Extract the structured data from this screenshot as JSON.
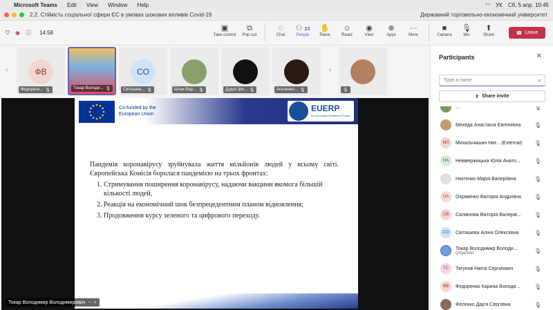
{
  "menubar": {
    "app": "Microsoft Teams",
    "items": [
      "Edit",
      "View",
      "Window",
      "Help"
    ],
    "lang": "УК",
    "clock": "Сб, 5 апр.  10:45"
  },
  "window": {
    "title": "2.2. Стійкість соціальної сфери ЄС в умовах шокових впливів Covid-19",
    "org": "Державний торговельно-економічний університет"
  },
  "toolbar": {
    "timer": "14:58",
    "tools": [
      {
        "label": "Take control",
        "icon": "hand-screen-icon"
      },
      {
        "label": "Pop out",
        "icon": "pop-out-icon"
      },
      {
        "label": "Chat",
        "icon": "chat-icon"
      },
      {
        "label": "People",
        "icon": "people-icon",
        "count": "23"
      },
      {
        "label": "Raise",
        "icon": "raise-hand-icon"
      },
      {
        "label": "React",
        "icon": "react-icon"
      },
      {
        "label": "View",
        "icon": "view-icon"
      },
      {
        "label": "Apps",
        "icon": "apps-icon"
      },
      {
        "label": "More",
        "icon": "more-icon"
      }
    ],
    "camera": "Camera",
    "mic": "Mic",
    "share": "Share",
    "leave": "Leave"
  },
  "tiles": [
    {
      "initials": "ФВ",
      "name": "Федоренк...",
      "color": "#f3d6d0",
      "fg": "#8a3a2a"
    },
    {
      "initials": "",
      "name": "Токар Володи...",
      "color": "#6aa0d8",
      "fg": "#fff"
    },
    {
      "initials": "CO",
      "name": "Світашев...",
      "color": "#cfe3f6",
      "fg": "#1e4e8c"
    },
    {
      "initials": "",
      "name": "Шпак Вар...",
      "color": "#8aa06a",
      "fg": "#fff"
    },
    {
      "initials": "",
      "name": "Дудка Іри...",
      "color": "#111111",
      "fg": "#fff"
    },
    {
      "initials": "",
      "name": "Асєченко...",
      "color": "#2a1a14",
      "fg": "#fff"
    },
    {
      "initials": "",
      "name": "",
      "color": "#b08060",
      "fg": "#fff"
    }
  ],
  "slide": {
    "cofunded": "Co-funded by the",
    "eu": "European Union",
    "euerp": "EUERP",
    "euerp_sub": "EU Economic Resilience Policy",
    "intro": "Пандемія коронавірусу зруйнувала життя мільйонів людей у всьому світі. Європейська Комісія боролася пандемією на трьох фронтах:",
    "points": [
      "Стримування поширення коронавірусу, надаючи вакцини якомога більшій кількості людей,",
      "Реакція на економічний шок безпрецедентним планом відновлення;",
      "Продовження курсу зеленого та цифрового переходу."
    ],
    "presenter": "Токар Володимир Володимирович"
  },
  "panel": {
    "title": "Participants",
    "search_placeholder": "Type a name",
    "invite": "Share invite",
    "participants": [
      {
        "initials": "",
        "name": "...",
        "sub": "",
        "color": "#7a9a5a",
        "fg": "#fff",
        "muted": true
      },
      {
        "initials": "",
        "name": "Мехеда Анастасія Євгеніївна",
        "sub": "",
        "color": "#c49a6c",
        "fg": "#fff",
        "muted": true
      },
      {
        "initials": "МЛ",
        "name": "Михальчишин Нат... (External)",
        "sub": "",
        "color": "#f3d6d0",
        "fg": "#8a3a2a",
        "muted": true
      },
      {
        "initials": "НА",
        "name": "Невмержицька Юлія Анато...",
        "sub": "",
        "color": "#d6ead8",
        "fg": "#2a6a3a",
        "muted": true
      },
      {
        "initials": "",
        "name": "Нікітенко Марія Валеріївна",
        "sub": "",
        "color": "#e0e0e0",
        "fg": "#333",
        "muted": true
      },
      {
        "initials": "ОА",
        "name": "Охріменко Вікторія Андріївна",
        "sub": "",
        "color": "#f6dccf",
        "fg": "#a0502a",
        "muted": true
      },
      {
        "initials": "СВ",
        "name": "Салівнова Вікторія Валерів...",
        "sub": "",
        "color": "#f3d6d0",
        "fg": "#8a3a2a",
        "muted": true
      },
      {
        "initials": "CO",
        "name": "Світашева Аліна Олексіївна",
        "sub": "",
        "color": "#cfe3f6",
        "fg": "#1e4e8c",
        "muted": true
      },
      {
        "initials": "",
        "name": "Токар Володимир Володи...",
        "sub": "Organizer",
        "color": "#6aa0d8",
        "fg": "#fff",
        "muted": false
      },
      {
        "initials": "ТС",
        "name": "Тягунов Нікіта Сергійович",
        "sub": "",
        "color": "#f6d6e6",
        "fg": "#8a2a5a",
        "muted": true
      },
      {
        "initials": "ФВ",
        "name": "Федоренко Карина Володи...",
        "sub": "",
        "color": "#f3d6d0",
        "fg": "#8a3a2a",
        "muted": true
      },
      {
        "initials": "",
        "name": "Фесенко Дар'я Сергіївна",
        "sub": "",
        "color": "#8a6a5a",
        "fg": "#fff",
        "muted": true
      }
    ]
  },
  "colors": {
    "accent": "#5b5fc7",
    "leave": "#c4314b"
  }
}
